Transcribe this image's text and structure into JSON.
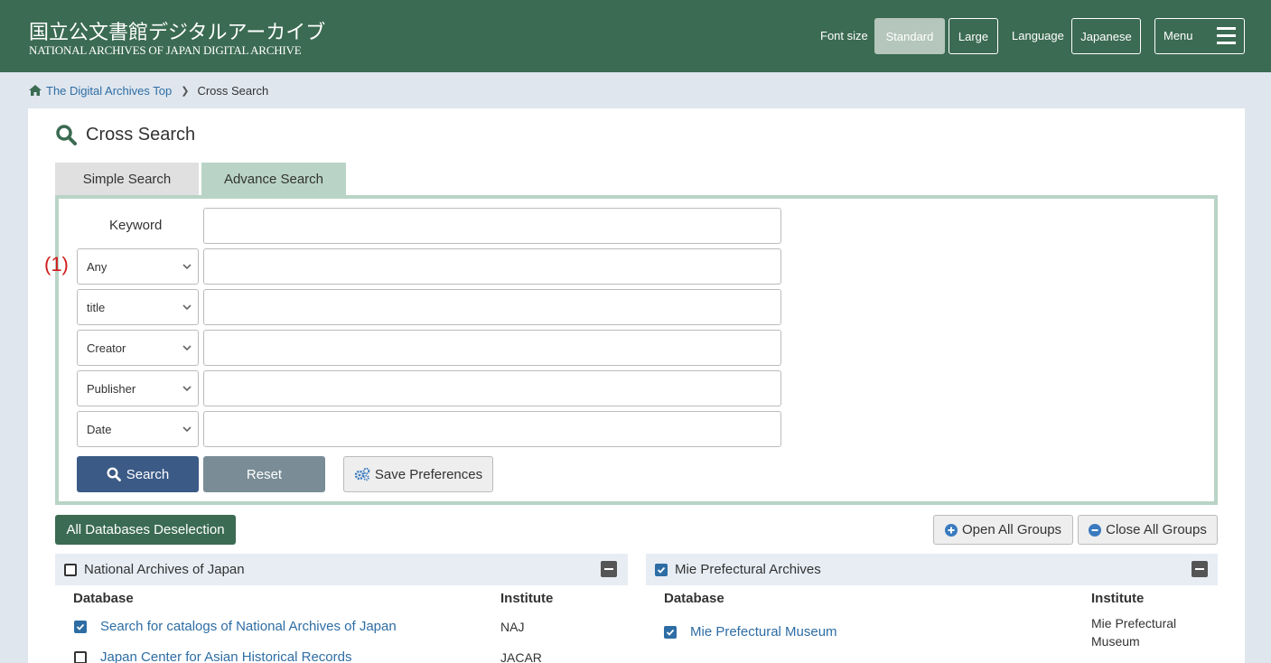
{
  "header": {
    "logo_jp": "国立公文書館デジタルアーカイブ",
    "logo_en": "NATIONAL ARCHIVES OF JAPAN  DIGITAL ARCHIVE",
    "font_size_label": "Font size",
    "font_standard": "Standard",
    "font_large": "Large",
    "language_label": "Language",
    "language_button": "Japanese",
    "menu_label": "Menu"
  },
  "breadcrumb": {
    "home": "The Digital Archives Top",
    "current": "Cross Search"
  },
  "page": {
    "title": "Cross Search"
  },
  "tabs": {
    "simple": "Simple Search",
    "advance": "Advance Search"
  },
  "form": {
    "keyword_label": "Keyword",
    "annotation": "(1)",
    "fields": [
      {
        "select": "Any",
        "value": ""
      },
      {
        "select": "title",
        "value": ""
      },
      {
        "select": "Creator",
        "value": ""
      },
      {
        "select": "Publisher",
        "value": ""
      },
      {
        "select": "Date",
        "value": ""
      }
    ],
    "search_button": "Search",
    "reset_button": "Reset",
    "save_button": "Save Preferences"
  },
  "groups_bar": {
    "deselect_all": "All Databases Deselection",
    "open_all": "Open All Groups",
    "close_all": "Close All Groups"
  },
  "groups": [
    {
      "name": "National Archives of Japan",
      "checked": false,
      "col_database": "Database",
      "col_institute": "Institute",
      "rows": [
        {
          "database": "Search for catalogs of National Archives of Japan",
          "institute": "NAJ",
          "checked": true
        },
        {
          "database": "Japan Center for Asian Historical Records",
          "institute": "JACAR",
          "checked": false
        }
      ]
    },
    {
      "name": "Mie Prefectural Archives",
      "checked": true,
      "col_database": "Database",
      "col_institute": "Institute",
      "rows": [
        {
          "database": "Mie Prefectural Museum",
          "institute_line1": "Mie Prefectural",
          "institute_line2": "Museum",
          "checked": true
        }
      ]
    }
  ],
  "colors": {
    "header_bg": "#3b6b52",
    "link": "#2e6da4",
    "search_button": "#3b5a86",
    "tab_active": "#b9d4c6",
    "annotation": "#d01c1c"
  }
}
